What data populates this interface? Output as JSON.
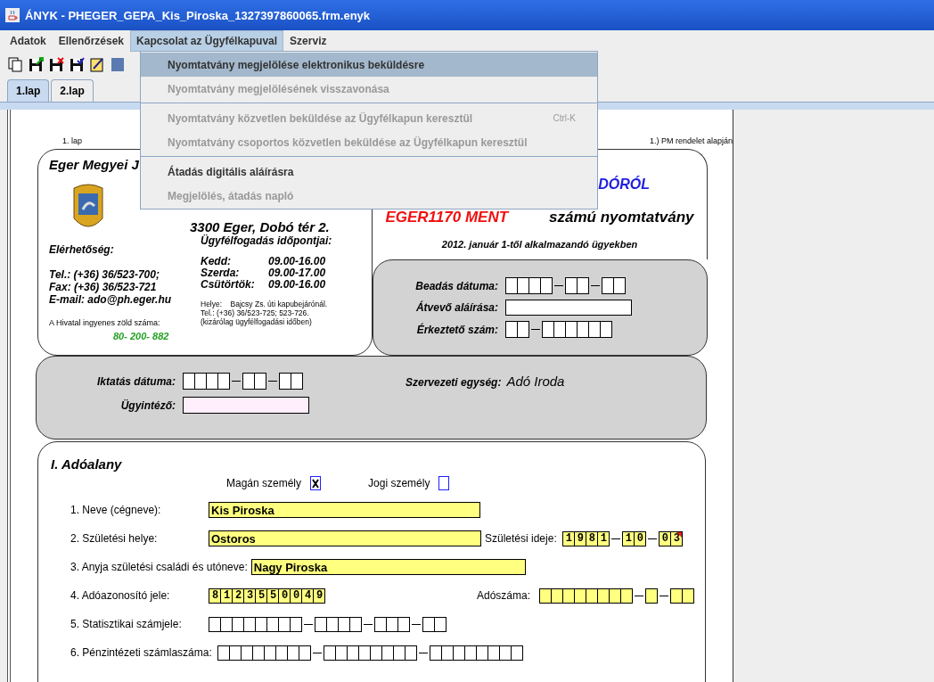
{
  "window": {
    "title": "ÁNYK - PHEGER_GEPA_Kis_Piroska_1327397860065.frm.enyk"
  },
  "menubar": [
    {
      "label": "Adatok",
      "selected": false
    },
    {
      "label": "Ellenőrzések",
      "selected": false
    },
    {
      "label": "Kapcsolat az Ügyfélkapuval",
      "selected": true
    },
    {
      "label": "Szerviz",
      "selected": false
    }
  ],
  "menu": {
    "items": [
      {
        "label": "Nyomtatvány megjelölése elektronikus beküldésre",
        "selected": true,
        "disabled": false,
        "separator_before": false
      },
      {
        "label": "Nyomtatvány megjelölésének visszavonása",
        "selected": false,
        "disabled": true,
        "separator_before": false
      },
      {
        "label": "Nyomtatvány közvetlen beküldése az Ügyfélkapun keresztül",
        "shortcut": "Ctrl-K",
        "selected": false,
        "disabled": true,
        "separator_before": true
      },
      {
        "label": "Nyomtatvány csoportos közvetlen beküldése az Ügyfélkapun keresztül",
        "selected": false,
        "disabled": true,
        "separator_before": false
      },
      {
        "label": "Átadás digitális aláírásra",
        "selected": false,
        "disabled": false,
        "separator_before": true
      },
      {
        "label": "Megjelölés, átadás napló",
        "selected": false,
        "disabled": true,
        "separator_before": false
      }
    ]
  },
  "tabs": [
    {
      "label": "1.lap",
      "selected": true
    },
    {
      "label": "2.lap",
      "selected": false
    }
  ],
  "form": {
    "page_label": "1. lap",
    "legal_note": "1.) PM rendelet alapján",
    "office": {
      "name": "Eger Megyei J",
      "address": "3300 Eger, Dobó tér 2.",
      "contact_heading": "Elérhetőség:",
      "contact_lines": [
        "Tel.: (+36) 36/523-700;",
        "Fax: (+36) 36/523-721",
        "E-mail: ado@ph.eger.hu"
      ],
      "free_number_label": "A Hivatal ingyenes zöld száma:",
      "free_number": "80- 200- 882",
      "hours_heading": "Ügyfélfogadás időpontjai:",
      "hours": [
        {
          "day": "Kedd:",
          "time": "09.00-16.00"
        },
        {
          "day": "Szerda:",
          "time": "09.00-17.00"
        },
        {
          "day": "Csütörtök:",
          "time": "09.00-16.00"
        }
      ],
      "location_lines": [
        "Helye:    Bajcsy Zs. úti kapubejárónál.",
        "Tel.: (+36) 36/523-725; 523-726.",
        "(kizárólag ügyfélfogadási időben)"
      ]
    },
    "form_title": {
      "title_tail": "DÓRÓL",
      "form_code": "EGER1170 MENT",
      "form_code_suffix": "számú nyomtatvány",
      "validity": "2012. január 1-től alkalmazandó ügyekben"
    },
    "receipt": {
      "submit_date_label": "Beadás dátuma:",
      "signature_label": "Átvevő aláírása:",
      "reg_number_label": "Érkeztető szám:"
    },
    "registration": {
      "filing_date_label": "Iktatás dátuma:",
      "clerk_label": "Ügyintéző:",
      "unit_label": "Szervezeti egység:",
      "unit": "Adó Iroda"
    },
    "taxpayer": {
      "heading": "I. Adóalany",
      "person_types": [
        {
          "label": "Magán személy",
          "checked": true
        },
        {
          "label": "Jogi személy",
          "checked": false
        }
      ],
      "name_label": "1. Neve (cégneve):",
      "name": "Kis Piroska",
      "birthplace_label": "2. Születési helye:",
      "birthplace": "Ostoros",
      "birthdate_label": "Születési ideje:",
      "birthdate": [
        "1981",
        "10",
        "03"
      ],
      "birthdate_flagged": true,
      "mother_label": "3. Anyja születési családi és utóneve:",
      "mother": "Nagy Piroska",
      "tax_id_label": "4. Adóazonosító jele:",
      "tax_id": "8123550049",
      "tax_number_label": "Adószáma:",
      "stat_label": "5. Statisztikai számjele:",
      "bank_label": "6. Pénzintézeti számlaszáma:"
    }
  }
}
